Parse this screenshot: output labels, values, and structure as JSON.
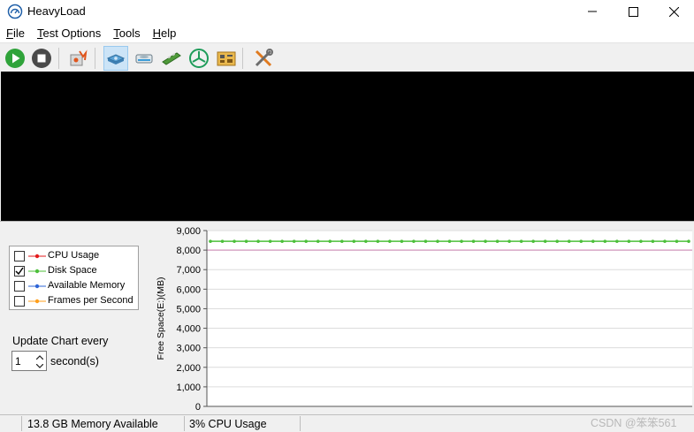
{
  "window": {
    "title": "HeavyLoad"
  },
  "menu": [
    {
      "accel": "F",
      "rest": "ile"
    },
    {
      "accel": "T",
      "rest": "est Options"
    },
    {
      "accel": "T",
      "rest": "ools"
    },
    {
      "accel": "H",
      "rest": "elp"
    }
  ],
  "toolbar": {
    "buttons": [
      {
        "name": "start-test-button",
        "icon": "play-icon"
      },
      {
        "name": "stop-test-button",
        "icon": "stop-icon"
      },
      {
        "name": "cpu-stress-button",
        "icon": "cpu-icon"
      },
      {
        "name": "disk-stress-button",
        "icon": "hard-disk-icon",
        "active": true
      },
      {
        "name": "disk-space-button",
        "icon": "drive-icon"
      },
      {
        "name": "memory-stress-button",
        "icon": "memory-icon"
      },
      {
        "name": "gpu-stress-button",
        "icon": "gpu-icon"
      },
      {
        "name": "pc-info-button",
        "icon": "board-icon"
      },
      {
        "name": "tools-button",
        "icon": "wrench-screwdriver-icon"
      }
    ]
  },
  "legend": {
    "items": [
      {
        "label": "CPU Usage",
        "checked": false,
        "color": "#e31a1c"
      },
      {
        "label": "Disk Space",
        "checked": true,
        "color": "#4cbf3a"
      },
      {
        "label": "Available Memory",
        "checked": false,
        "color": "#2e64d6"
      },
      {
        "label": "Frames per Second",
        "checked": false,
        "color": "#ff9f1c"
      }
    ]
  },
  "update": {
    "label": "Update Chart every",
    "value": "1",
    "unit": "second(s)"
  },
  "status": {
    "memory": "13.8 GB Memory Available",
    "cpu": "3% CPU Usage"
  },
  "watermark": "CSDN @笨笨561",
  "chart_data": {
    "type": "line",
    "ylabel": "Free Space(E:)(MB)",
    "ylim": [
      0,
      9000
    ],
    "yticks": [
      0,
      1000,
      2000,
      3000,
      4000,
      5000,
      6000,
      7000,
      8000,
      9000
    ],
    "ytick_labels": [
      "0",
      "1,000",
      "2,000",
      "3,000",
      "4,000",
      "5,000",
      "6,000",
      "7,000",
      "8,000",
      "9,000"
    ],
    "grid": true,
    "reference_line": {
      "value": 8000,
      "color": "#d9a7c7"
    },
    "series": [
      {
        "name": "Disk Space",
        "color": "#4cbf3a",
        "values": [
          8450,
          8450,
          8450,
          8450,
          8450,
          8450,
          8450,
          8450,
          8450,
          8450,
          8450,
          8450,
          8450,
          8450,
          8450,
          8450,
          8450,
          8450,
          8450,
          8450,
          8450,
          8450,
          8450,
          8450,
          8450,
          8450,
          8450,
          8450,
          8450,
          8450,
          8450,
          8450,
          8450,
          8450,
          8450,
          8450,
          8450,
          8450,
          8450,
          8450,
          8450
        ]
      }
    ]
  }
}
